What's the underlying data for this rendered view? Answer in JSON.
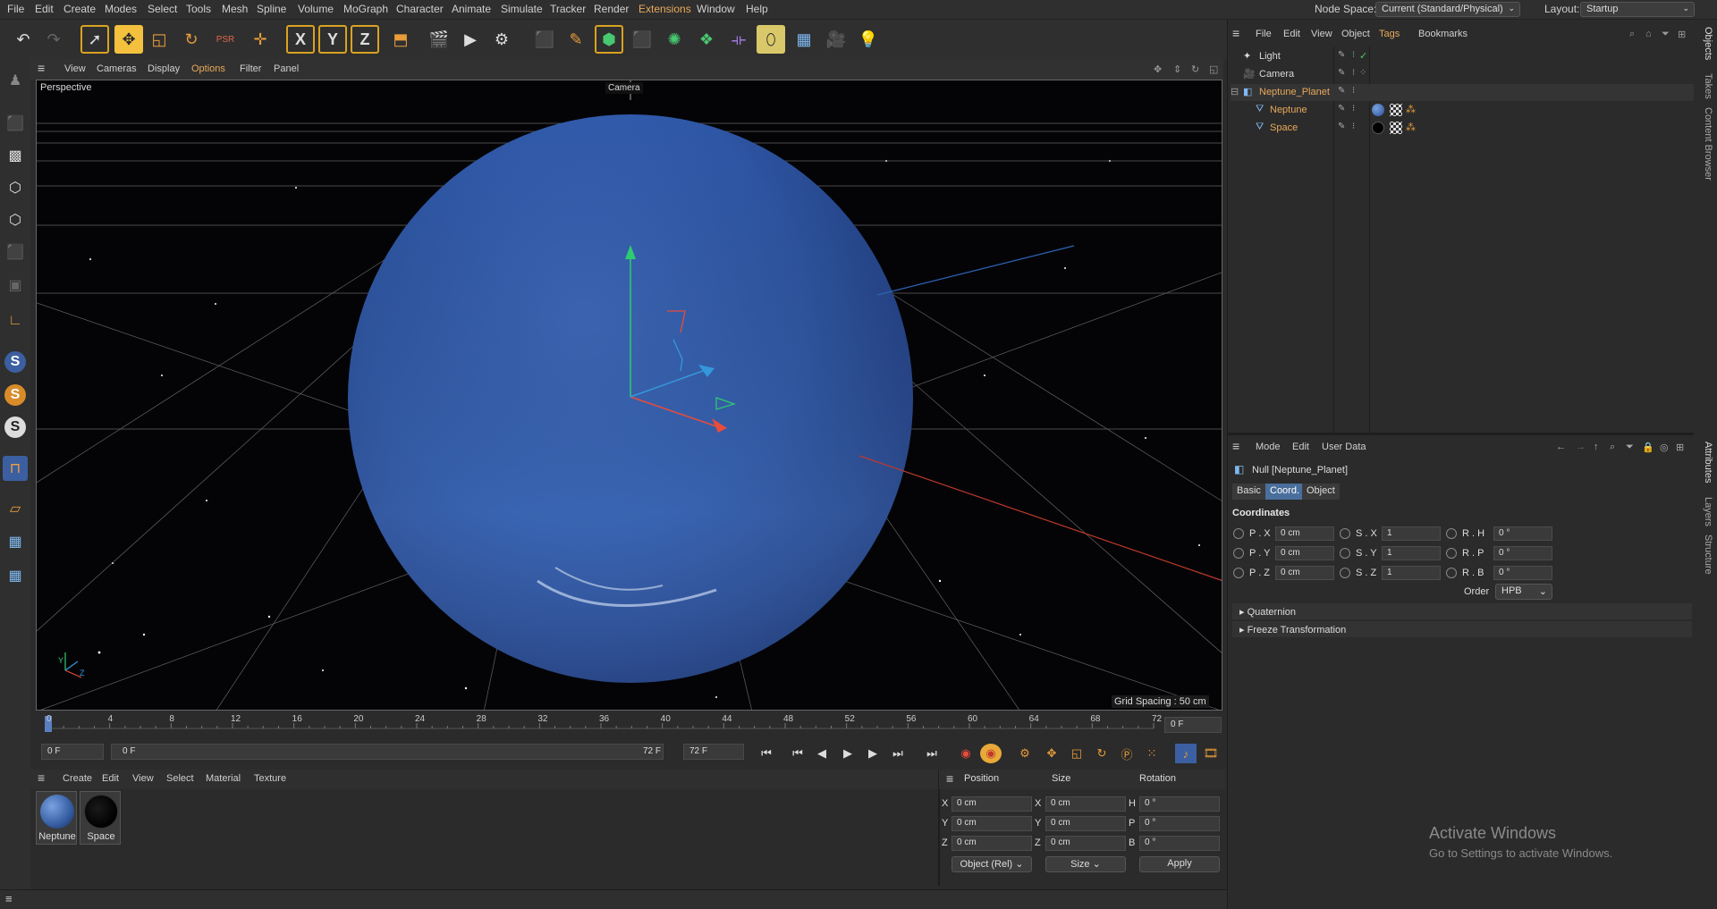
{
  "menubar": {
    "items": [
      "File",
      "Edit",
      "Create",
      "Modes",
      "Select",
      "Tools",
      "Mesh",
      "Spline",
      "Volume",
      "MoGraph",
      "Character",
      "Animate",
      "Simulate",
      "Tracker",
      "Render",
      "Extensions",
      "Window",
      "Help"
    ],
    "node_space_label": "Node Space:",
    "node_space_value": "Current (Standard/Physical)",
    "layout_label": "Layout:",
    "layout_value": "Startup"
  },
  "toolbar": {
    "icons": [
      "undo-icon",
      "redo-icon",
      "select-icon",
      "move-icon",
      "scale-icon",
      "rotate-icon",
      "psr-icon",
      "live-select-icon",
      "x-axis-icon",
      "y-axis-icon",
      "z-axis-icon",
      "coord-system-icon",
      "render-region-icon",
      "render-view-icon",
      "render-settings-icon",
      "cube-icon",
      "pen-icon",
      "subdivision-icon",
      "extrude-icon",
      "cloner-icon",
      "array-icon",
      "deformer-icon",
      "bend-icon",
      "floor-icon",
      "camera-icon",
      "light-icon"
    ],
    "xyz": [
      "X",
      "Y",
      "Z"
    ]
  },
  "viewport": {
    "menu": [
      "View",
      "Cameras",
      "Display",
      "Options",
      "Filter",
      "Panel"
    ],
    "label": "Perspective",
    "camera_label": "Camera",
    "grid_spacing": "Grid Spacing : 50 cm",
    "axis_y": "Y",
    "axis_z": "Z"
  },
  "timeline": {
    "ticks": [
      "0",
      "4",
      "8",
      "12",
      "16",
      "20",
      "24",
      "28",
      "32",
      "36",
      "40",
      "44",
      "48",
      "52",
      "56",
      "60",
      "64",
      "68",
      "72"
    ],
    "current_frame": "0 F",
    "start": "0 F",
    "range_start": "0 F",
    "range_end": "72 F",
    "end": "72 F"
  },
  "material_manager": {
    "menu": [
      "Create",
      "Edit",
      "View",
      "Select",
      "Material",
      "Texture"
    ],
    "materials": [
      {
        "name": "Neptune",
        "color": "#3a63a8"
      },
      {
        "name": "Space",
        "color": "#050505"
      }
    ]
  },
  "coordinates": {
    "headers": [
      "Position",
      "Size",
      "Rotation"
    ],
    "rows": [
      {
        "axis": "X",
        "pos": "0 cm",
        "size_axis": "X",
        "size": "0 cm",
        "rot_axis": "H",
        "rot": "0 °"
      },
      {
        "axis": "Y",
        "pos": "0 cm",
        "size_axis": "Y",
        "size": "0 cm",
        "rot_axis": "P",
        "rot": "0 °"
      },
      {
        "axis": "Z",
        "pos": "0 cm",
        "size_axis": "Z",
        "size": "0 cm",
        "rot_axis": "B",
        "rot": "0 °"
      }
    ],
    "mode": "Object (Rel)",
    "size_mode": "Size",
    "apply": "Apply"
  },
  "object_manager": {
    "menu": [
      "File",
      "Edit",
      "View",
      "Object",
      "Tags",
      "Bookmarks"
    ],
    "objects": [
      {
        "name": "Light",
        "orange": false,
        "indent": 0
      },
      {
        "name": "Camera",
        "orange": false,
        "indent": 0
      },
      {
        "name": "Neptune_Planet",
        "orange": true,
        "indent": 0
      },
      {
        "name": "Neptune",
        "orange": true,
        "indent": 1
      },
      {
        "name": "Space",
        "orange": true,
        "indent": 1
      }
    ]
  },
  "side_tabs_top": [
    "Objects",
    "Takes",
    "Content Browser"
  ],
  "side_tabs_bottom": [
    "Attributes",
    "Layers",
    "Structure"
  ],
  "attributes": {
    "menu": [
      "Mode",
      "Edit",
      "User Data"
    ],
    "title": "Null [Neptune_Planet]",
    "tabs": [
      "Basic",
      "Coord.",
      "Object"
    ],
    "section": "Coordinates",
    "fields": [
      {
        "label": "P . X",
        "value": "0 cm",
        "slabel": "S . X",
        "svalue": "1",
        "rlabel": "R . H",
        "rvalue": "0 °"
      },
      {
        "label": "P . Y",
        "value": "0 cm",
        "slabel": "S . Y",
        "svalue": "1",
        "rlabel": "R . P",
        "rvalue": "0 °"
      },
      {
        "label": "P . Z",
        "value": "0 cm",
        "slabel": "S . Z",
        "svalue": "1",
        "rlabel": "R . B",
        "rvalue": "0 °"
      }
    ],
    "order_label": "Order",
    "order_value": "HPB",
    "collapsed": [
      "Quaternion",
      "Freeze Transformation"
    ]
  },
  "watermark": {
    "title": "Activate Windows",
    "subtitle": "Go to Settings to activate Windows."
  },
  "colors": {
    "accent": "#f3c13d",
    "orange_text": "#e8a95a",
    "planet": "#3b5fa8"
  }
}
